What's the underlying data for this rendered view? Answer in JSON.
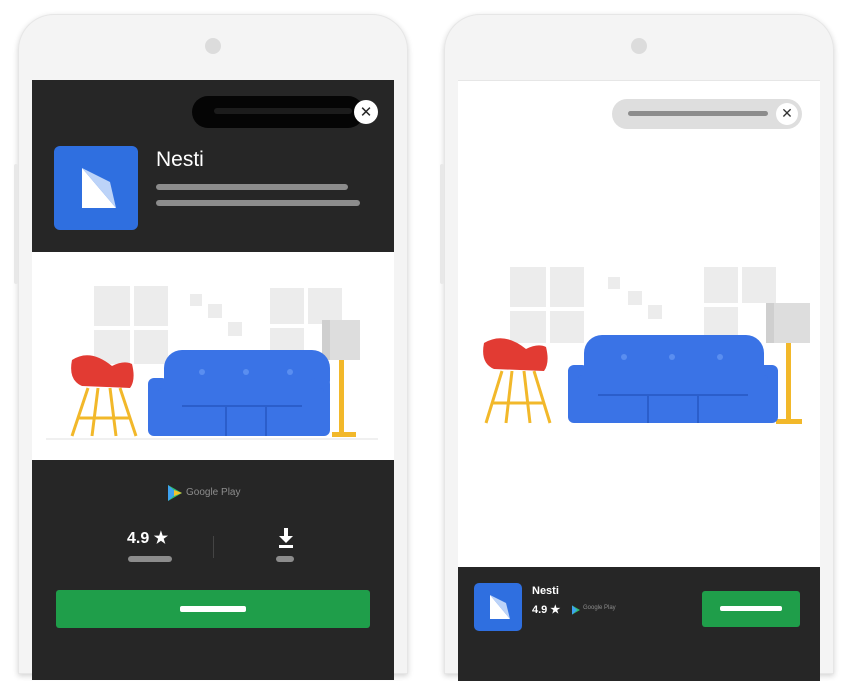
{
  "colors": {
    "ad_dark": "#262626",
    "app_icon_blue": "#2f6fe0",
    "install_green": "#1f9e4a",
    "sofa_blue": "#3a73e6",
    "chair_red": "#e23b33",
    "lamp_yellow": "#f2b82a"
  },
  "left_phone": {
    "close_icon": "close-icon",
    "app_name": "Nesti",
    "store_label": "Google Play",
    "rating": "4.9 ★",
    "download_icon": "download-icon"
  },
  "right_phone": {
    "close_icon": "close-icon",
    "app_name": "Nesti",
    "rating": "4.9 ★",
    "store_label": "Google Play"
  }
}
